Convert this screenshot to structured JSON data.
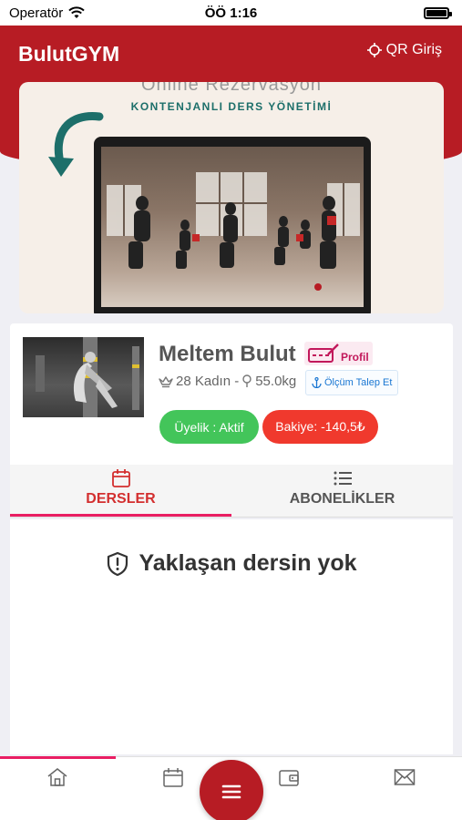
{
  "status_bar": {
    "carrier": "Operatör",
    "time": "ÖÖ 1:16"
  },
  "header": {
    "app_title": "BulutGYM",
    "qr_label": "QR Giriş"
  },
  "banner": {
    "title": "Online Rezervasyon",
    "subtitle": "KONTENJANLI DERS YÖNETİMİ"
  },
  "profile": {
    "name": "Meltem Bulut",
    "profile_link": "Profil",
    "age_gender": "28 Kadın -",
    "weight": "55.0kg",
    "measure_button": "Ölçüm Talep Et",
    "membership": "Üyelik : Aktif",
    "balance": "Bakiye: -140,5₺"
  },
  "tabs": [
    {
      "label": "DERSLER",
      "icon": "calendar-icon",
      "active": true
    },
    {
      "label": "ABONELİKLER",
      "icon": "list-icon",
      "active": false
    }
  ],
  "content": {
    "empty_message": "Yaklaşan dersin yok"
  },
  "bottom_nav": [
    "home-icon",
    "calendar-icon",
    "menu-icon",
    "wallet-icon",
    "mail-icon"
  ],
  "colors": {
    "brand": "#b71c24",
    "accent": "#e91e63",
    "success": "#43c55a",
    "danger": "#f0392d"
  }
}
